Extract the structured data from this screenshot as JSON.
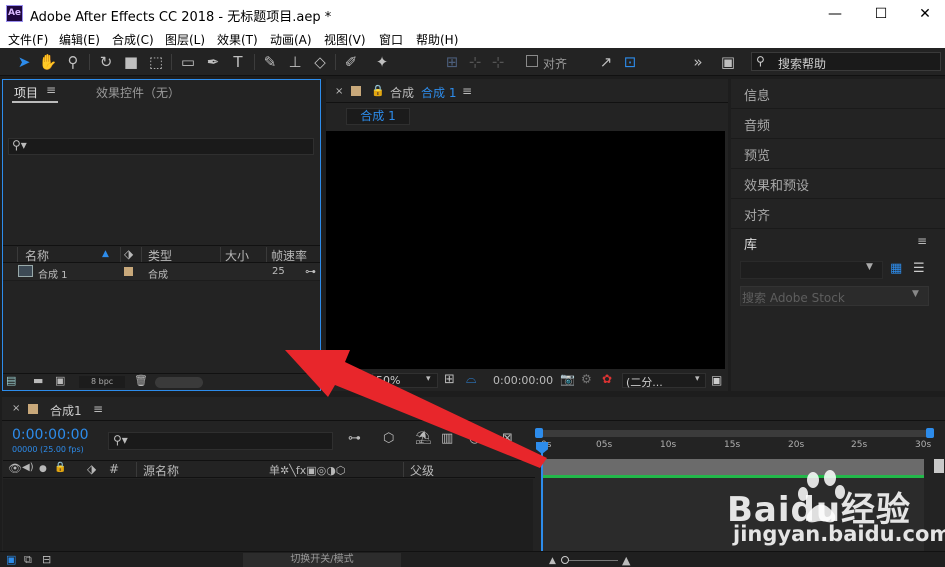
{
  "window": {
    "app_icon": "Ae",
    "title": "Adobe After Effects CC 2018 - 无标题项目.aep *",
    "minimize": "—",
    "maximize": "☐",
    "close": "✕"
  },
  "menu": [
    "文件(F)",
    "编辑(E)",
    "合成(C)",
    "图层(L)",
    "效果(T)",
    "动画(A)",
    "视图(V)",
    "窗口",
    "帮助(H)"
  ],
  "toolbar": {
    "snap_label": "对齐",
    "help_search": "搜索帮助"
  },
  "project_panel": {
    "tab_project": "项目",
    "tab_effects": "效果控件（无）",
    "columns": {
      "name": "名称",
      "type": "类型",
      "size": "大小",
      "fps": "帧速率"
    },
    "rows": [
      {
        "name": "合成 1",
        "type": "合成",
        "size": "",
        "fps": "25"
      }
    ],
    "bpc": "8 bpc"
  },
  "viewer": {
    "tab_prefix": "合成",
    "tab_name": "合成 1",
    "chip": "合成 1",
    "zoom": "50%",
    "timecode": "0:00:00:00",
    "resolution": "(二分..."
  },
  "right_panel": {
    "items": [
      "信息",
      "音频",
      "预览",
      "效果和预设",
      "对齐"
    ],
    "library": "库",
    "stock_search": "搜索 Adobe Stock"
  },
  "timeline": {
    "tab": "合成1",
    "timecode": "0:00:00:00",
    "frames": "00000 (25.00 fps)",
    "col_hash": "#",
    "col_source": "源名称",
    "col_switches": "单✲╲fx▣◎◑⬡",
    "col_parent": "父级",
    "ruler_ticks": [
      "0s",
      "05s",
      "10s",
      "15s",
      "20s",
      "25s",
      "30s"
    ],
    "switch_modes": "切换开关/模式"
  },
  "watermark": {
    "text": "Baidu经验",
    "url": "jingyan.baidu.com"
  },
  "colors": {
    "accent": "#2d8ceb",
    "arrow": "#e8262b",
    "green": "#23b84a"
  }
}
